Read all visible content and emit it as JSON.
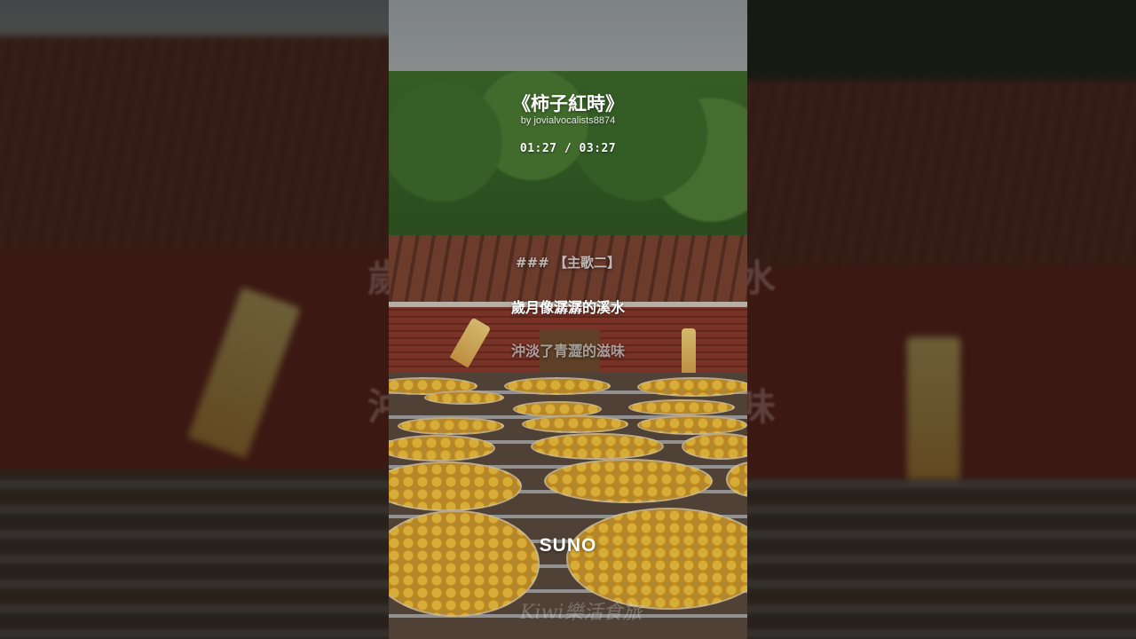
{
  "video": {
    "title": "《柿子紅時》",
    "artist": "by jovialvocalists8874",
    "time_display": "01:27 / 03:27",
    "lyrics": {
      "section_header": "### 【主歌二】",
      "current_line": "歲月像潺潺的溪水",
      "next_line": "沖淡了青澀的滋味"
    },
    "brand": "SUNO",
    "watermark": "Kiwi樂活食旅"
  },
  "background_ghost_text": {
    "left_top": "歲",
    "left_bottom": "沖",
    "right_top": "水",
    "right_bottom": "味"
  },
  "colors": {
    "sky": "#a4a8a7",
    "foliage": "#3e6a2c",
    "roof": "#6e3d2e",
    "brick": "#843a2c",
    "persimmon": "#f5c542"
  }
}
